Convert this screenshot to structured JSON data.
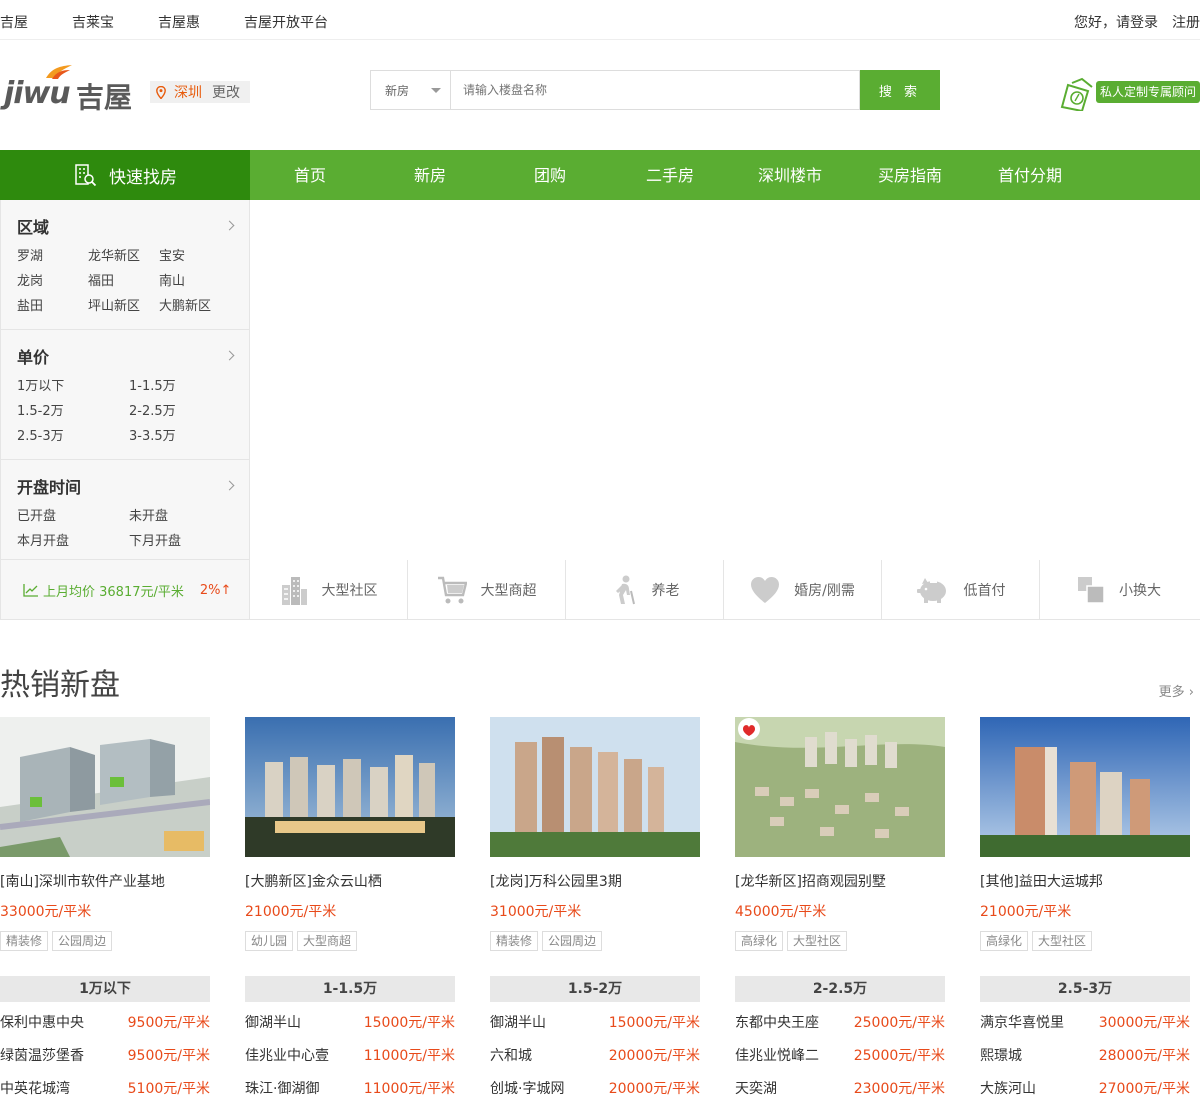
{
  "topbar": {
    "links": [
      "吉屋",
      "吉莱宝",
      "吉屋惠",
      "吉屋开放平台"
    ],
    "greeting": "您好，请登录",
    "register": "注册"
  },
  "header": {
    "logo_latin": "jiwu",
    "logo_cn": "吉屋",
    "city": "深圳",
    "change_city": "更改",
    "search_type": "新房",
    "search_placeholder": "请输入楼盘名称",
    "search_button": "搜 索",
    "custom_consultant": "私人定制专属顾问"
  },
  "nav": {
    "quick_find": "快速找房",
    "items": [
      "首页",
      "新房",
      "团购",
      "二手房",
      "深圳楼市",
      "买房指南",
      "首付分期"
    ]
  },
  "sidebar": {
    "groups": [
      {
        "title": "区域",
        "options": [
          "罗湖",
          "龙华新区",
          "宝安",
          "龙岗",
          "福田",
          "南山",
          "盐田",
          "坪山新区",
          "大鹏新区"
        ]
      },
      {
        "title": "单价",
        "options": [
          "1万以下",
          "1-1.5万",
          "1.5-2万",
          "2-2.5万",
          "2.5-3万",
          "3-3.5万"
        ]
      },
      {
        "title": "开盘时间",
        "options": [
          "已开盘",
          "未开盘",
          "本月开盘",
          "下月开盘"
        ]
      }
    ],
    "avg_price": "上月均价 36817元/平米",
    "avg_change": "2%↑"
  },
  "feature_tags": [
    {
      "label": "大型社区",
      "icon": "building-icon"
    },
    {
      "label": "大型商超",
      "icon": "cart-icon"
    },
    {
      "label": "养老",
      "icon": "elderly-icon"
    },
    {
      "label": "婚房/刚需",
      "icon": "heart-icon"
    },
    {
      "label": "低首付",
      "icon": "piggy-bank-icon"
    },
    {
      "label": "小换大",
      "icon": "squares-icon"
    }
  ],
  "hot": {
    "title": "热销新盘",
    "more": "更多",
    "cards": [
      {
        "name": "[南山]深圳市软件产业基地",
        "price": "33000元/平米",
        "labels": [
          "精装修",
          "公园周边"
        ],
        "band": "1万以下",
        "rows": [
          {
            "n": "保利中惠中央",
            "v": "9500元/平米"
          },
          {
            "n": "绿茵温莎堡香",
            "v": "9500元/平米"
          },
          {
            "n": "中英花城湾",
            "v": "5100元/平米"
          }
        ]
      },
      {
        "name": "[大鹏新区]金众云山栖",
        "price": "21000元/平米",
        "labels": [
          "幼儿园",
          "大型商超"
        ],
        "band": "1-1.5万",
        "rows": [
          {
            "n": "御湖半山",
            "v": "15000元/平米"
          },
          {
            "n": "佳兆业中心壹",
            "v": "11000元/平米"
          },
          {
            "n": "珠江·御湖御",
            "v": "11000元/平米"
          }
        ]
      },
      {
        "name": "[龙岗]万科公园里3期",
        "price": "31000元/平米",
        "labels": [
          "精装修",
          "公园周边"
        ],
        "band": "1.5-2万",
        "rows": [
          {
            "n": "御湖半山",
            "v": "15000元/平米"
          },
          {
            "n": "六和城",
            "v": "20000元/平米"
          },
          {
            "n": "创城·字城网",
            "v": "20000元/平米"
          }
        ]
      },
      {
        "name": "[龙华新区]招商观园别墅",
        "price": "45000元/平米",
        "labels": [
          "高绿化",
          "大型社区"
        ],
        "band": "2-2.5万",
        "rows": [
          {
            "n": "东都中央王座",
            "v": "25000元/平米"
          },
          {
            "n": "佳兆业悦峰二",
            "v": "25000元/平米"
          },
          {
            "n": "天奕湖",
            "v": "23000元/平米"
          }
        ]
      },
      {
        "name": "[其他]益田大运城邦",
        "price": "21000元/平米",
        "labels": [
          "高绿化",
          "大型社区"
        ],
        "band": "2.5-3万",
        "rows": [
          {
            "n": "满京华喜悦里",
            "v": "30000元/平米"
          },
          {
            "n": "熙璟城",
            "v": "28000元/平米"
          },
          {
            "n": "大族河山",
            "v": "27000元/平米"
          }
        ]
      }
    ]
  },
  "colors": {
    "brand_green": "#5aad32",
    "dark_green": "#2e8a0d",
    "price_red": "#e84a1a",
    "city_orange": "#e85c0d"
  }
}
